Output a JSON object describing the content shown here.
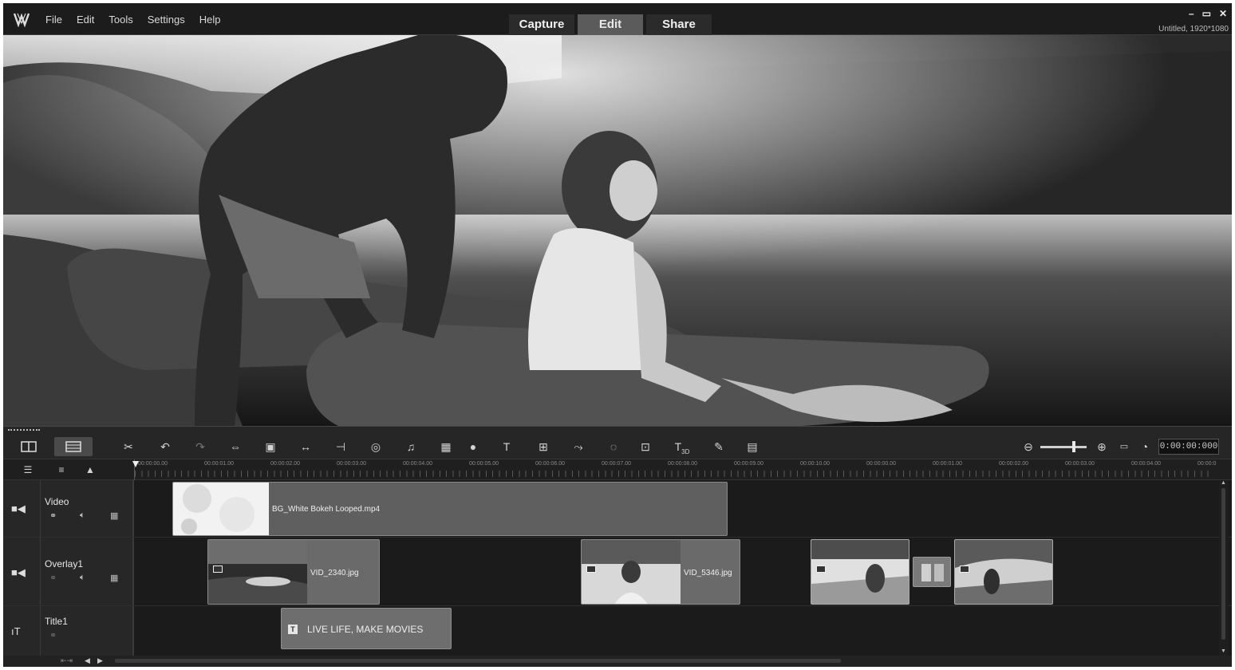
{
  "menu": {
    "file": "File",
    "edit": "Edit",
    "tools": "Tools",
    "settings": "Settings",
    "help": "Help"
  },
  "modes": {
    "capture": "Capture",
    "edit": "Edit",
    "share": "Share",
    "active": "Edit"
  },
  "window": {
    "minimize": "–",
    "restore": "▭",
    "close": "✕",
    "project_info": "Untitled, 1920*1080"
  },
  "timecode": "0:00:00:000",
  "ruler_labels": [
    "00:00:00.00",
    "00:00:01.00",
    "00:00:02.00",
    "00:00:03.00",
    "00:00:04.00",
    "00:00:05.00",
    "00:00:06.00",
    "00:00:07.00",
    "00:00:08.00",
    "00:00:09.00",
    "00:00:10.00",
    "00:00:00.00",
    "00:00:01.00",
    "00:00:02.00",
    "00:00:03.00",
    "00:00:04.00",
    "00:00:0"
  ],
  "tracks": {
    "video": {
      "name": "Video",
      "clip": "BG_White Bokeh Looped.mp4"
    },
    "overlay": {
      "name": "Overlay1",
      "clips": [
        "VID_2340.jpg",
        "VID_5346.jpg"
      ]
    },
    "title": {
      "name": "Title1",
      "clip": "LIVE LIFE, MAKE MOVIES"
    }
  },
  "icons": [
    "storyboard-view",
    "timeline-view",
    "tools",
    "undo",
    "redo",
    "fit",
    "crop",
    "trim",
    "split",
    "motion",
    "audio-mix",
    "multi-camera",
    "color-grading",
    "title",
    "split-screen",
    "motion-tracking",
    "mask",
    "pan-zoom",
    "3d-title",
    "subtitle",
    "export",
    "zoom-out",
    "zoom-in",
    "fit-project",
    "clock"
  ]
}
